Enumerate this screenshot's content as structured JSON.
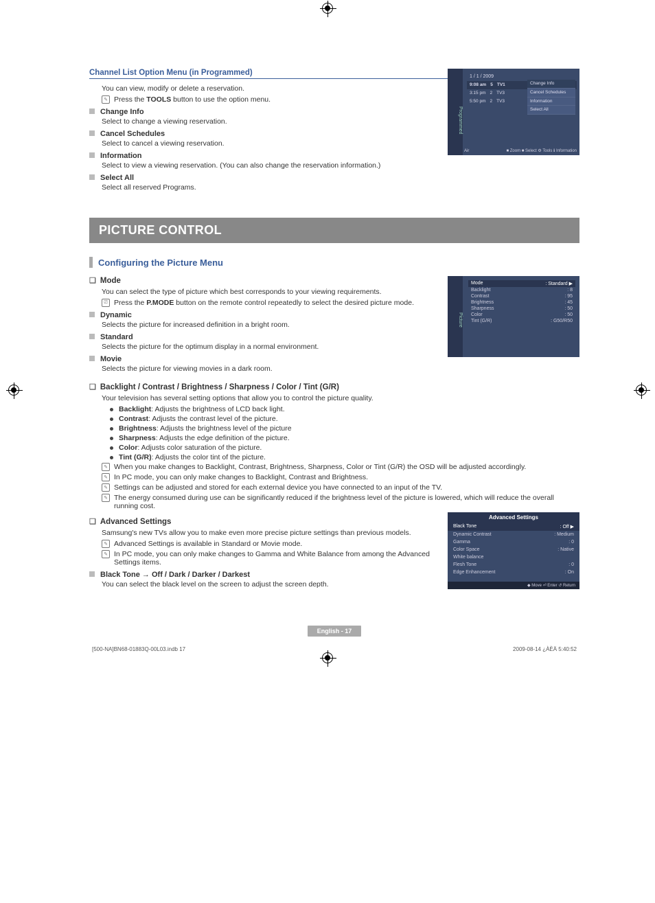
{
  "header": {
    "title": "Channel List Option Menu (in Programmed)",
    "intro": "You can view, modify or delete a reservation.",
    "note": "Press the TOOLS button to use the option menu.",
    "note_bold": "TOOLS"
  },
  "option_items": [
    {
      "title": "Change Info",
      "body": "Select to change a viewing reservation."
    },
    {
      "title": "Cancel Schedules",
      "body": "Select to cancel a viewing reservation."
    },
    {
      "title": "Information",
      "body": "Select to view a viewing reservation. (You can also change the reservation information.)"
    },
    {
      "title": "Select All",
      "body": "Select all reserved Programs."
    }
  ],
  "screenshot1": {
    "side_label": "Programmed",
    "date": "1 / 1 / 2009",
    "rows": [
      {
        "time": "9:08 am",
        "num": "5",
        "ch": "TV1"
      },
      {
        "time": "3:15 pm",
        "num": "2",
        "ch": "TV3"
      },
      {
        "time": "5:50 pm",
        "num": "2",
        "ch": "TV3"
      }
    ],
    "menu": [
      "Change Info",
      "Cancel Schedules",
      "Information",
      "Select All"
    ],
    "footer_left": "Air",
    "footer_zoom": "■ Zoom",
    "footer_select": "■ Select",
    "footer_tools": "⚙ Tools",
    "footer_info": "ℹ Information"
  },
  "band_title": "PICTURE CONTROL",
  "sub_title": "Configuring the Picture Menu",
  "mode": {
    "heading": "Mode",
    "intro": "You can select the type of picture which best corresponds to your viewing requirements.",
    "note": "Press the P.MODE button on the remote control repeatedly to select the desired picture mode.",
    "note_bold": "P.MODE",
    "items": [
      {
        "title": "Dynamic",
        "body": "Selects the picture for increased definition in a bright room."
      },
      {
        "title": "Standard",
        "body": "Selects the picture for the optimum display in a normal environment."
      },
      {
        "title": "Movie",
        "body": "Selects the picture for viewing movies in a dark room."
      }
    ]
  },
  "screenshot2": {
    "side_label": "Picture",
    "rows": [
      {
        "k": "Mode",
        "v": ": Standard",
        "sel": true
      },
      {
        "k": "Backlight",
        "v": ": 8"
      },
      {
        "k": "Contrast",
        "v": ": 95"
      },
      {
        "k": "Brightness",
        "v": ": 45"
      },
      {
        "k": "Sharpness",
        "v": ": 50"
      },
      {
        "k": "Color",
        "v": ": 50"
      },
      {
        "k": "Tint (G/R)",
        "v": ": G50/R50"
      }
    ]
  },
  "backlight": {
    "heading": "Backlight / Contrast / Brightness / Sharpness / Color / Tint (G/R)",
    "intro": "Your television has several setting options that allow you to control the picture quality.",
    "bullets": [
      {
        "b": "Backlight",
        "t": ": Adjusts the brightness of LCD back light."
      },
      {
        "b": "Contrast",
        "t": ": Adjusts the contrast level of the picture."
      },
      {
        "b": "Brightness",
        "t": ": Adjusts the brightness level of the picture"
      },
      {
        "b": "Sharpness",
        "t": ": Adjusts the edge definition of the picture."
      },
      {
        "b": "Color",
        "t": ": Adjusts color saturation of the picture."
      },
      {
        "b": "Tint (G/R)",
        "t": ": Adjusts the color tint of the picture."
      }
    ],
    "notes": [
      "When you make changes to Backlight, Contrast, Brightness, Sharpness, Color or Tint (G/R) the OSD will be adjusted accordingly.",
      "In PC mode, you can only make changes to Backlight, Contrast and Brightness.",
      "Settings can be adjusted and stored for each external device you have connected to an input of the TV.",
      "The energy consumed during use can be significantly reduced if the brightness level of the picture is lowered, which will reduce the overall running cost."
    ]
  },
  "advanced": {
    "heading": "Advanced Settings",
    "intro": "Samsung's new TVs allow you to make even more precise picture settings than previous models.",
    "notes": [
      "Advanced Settings is available in Standard or Movie mode.",
      "In PC mode, you can only make changes to Gamma and White Balance from among the Advanced Settings items."
    ],
    "item_title": "Black Tone → Off / Dark / Darker / Darkest",
    "item_body": "You can select the black level on the screen to adjust the screen depth."
  },
  "screenshot3": {
    "title": "Advanced Settings",
    "rows": [
      {
        "k": "Black Tone",
        "v": ": Off",
        "sel": true
      },
      {
        "k": "Dynamic Contrast",
        "v": ": Medium"
      },
      {
        "k": "Gamma",
        "v": ": 0"
      },
      {
        "k": "Color Space",
        "v": ": Native"
      },
      {
        "k": "White balance",
        "v": ""
      },
      {
        "k": "Flesh Tone",
        "v": ": 0"
      },
      {
        "k": "Edge Enhancement",
        "v": ": On"
      }
    ],
    "footer": "◆ Move    ⏎ Enter    ↺ Return"
  },
  "page_label": "English - 17",
  "footer_left": "[500-NA]BN68-01883Q-00L03.indb   17",
  "footer_right": "2009-08-14   ¿ÀÈÄ 5:40:52"
}
